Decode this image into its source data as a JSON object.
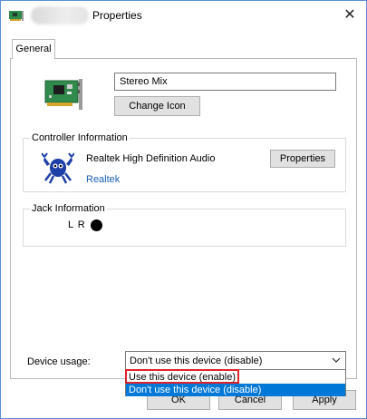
{
  "window": {
    "title": "Properties",
    "close_glyph": "✕"
  },
  "tabs": [
    {
      "label": "General"
    }
  ],
  "device": {
    "name": "Stereo Mix",
    "icon": "sound-card-icon",
    "change_icon_label": "Change Icon"
  },
  "controller": {
    "group_label": "Controller Information",
    "name": "Realtek High Definition Audio",
    "vendor": "Realtek",
    "icon": "realtek-crab-icon",
    "properties_label": "Properties"
  },
  "jack": {
    "group_label": "Jack Information",
    "channels": "L R",
    "dot_color": "#000000"
  },
  "usage": {
    "label": "Device usage:",
    "selected": "Don't use this device (disable)",
    "options": [
      "Use this device (enable)",
      "Don't use this device (disable)"
    ],
    "highlighted_option_index": 1
  },
  "footer": {
    "ok_label": "OK",
    "cancel_label": "Cancel",
    "apply_label": "Apply"
  },
  "colors": {
    "accent": "#0078d7",
    "highlight_border": "#e0232b",
    "link": "#1a5fb4"
  }
}
